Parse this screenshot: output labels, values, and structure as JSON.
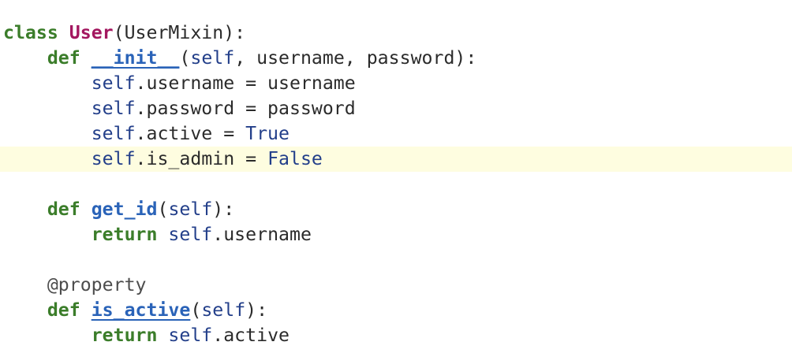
{
  "editor": {
    "language": "python",
    "current_line_index": 5,
    "colors": {
      "keyword": "#3b7d2a",
      "class_name": "#a3175f",
      "function_name": "#2a63b8",
      "self_and_literals": "#233f8a",
      "text": "#2b2b2b",
      "current_line_bg": "#fefde0"
    },
    "lines": [
      {
        "indent": "",
        "tokens": [
          {
            "t": "kw",
            "v": "class"
          },
          {
            "t": "plain",
            "v": " "
          },
          {
            "t": "cls",
            "v": "User"
          },
          {
            "t": "plain",
            "v": "(UserMixin):"
          }
        ]
      },
      {
        "indent": "    ",
        "tokens": [
          {
            "t": "kw",
            "v": "def"
          },
          {
            "t": "plain",
            "v": " "
          },
          {
            "t": "dunder",
            "v": "__init__"
          },
          {
            "t": "plain",
            "v": "("
          },
          {
            "t": "self",
            "v": "self"
          },
          {
            "t": "plain",
            "v": ", username, password):"
          }
        ]
      },
      {
        "indent": "        ",
        "tokens": [
          {
            "t": "self",
            "v": "self"
          },
          {
            "t": "plain",
            "v": ".username = username"
          }
        ]
      },
      {
        "indent": "        ",
        "tokens": [
          {
            "t": "self",
            "v": "self"
          },
          {
            "t": "plain",
            "v": ".password = password"
          }
        ]
      },
      {
        "indent": "        ",
        "tokens": [
          {
            "t": "self",
            "v": "self"
          },
          {
            "t": "plain",
            "v": ".active = "
          },
          {
            "t": "lit",
            "v": "True"
          }
        ]
      },
      {
        "indent": "        ",
        "tokens": [
          {
            "t": "self",
            "v": "self"
          },
          {
            "t": "plain",
            "v": ".is_admin = "
          },
          {
            "t": "lit",
            "v": "False"
          }
        ]
      },
      {
        "indent": "",
        "tokens": []
      },
      {
        "indent": "    ",
        "tokens": [
          {
            "t": "kw",
            "v": "def"
          },
          {
            "t": "plain",
            "v": " "
          },
          {
            "t": "fn",
            "v": "get_id"
          },
          {
            "t": "plain",
            "v": "("
          },
          {
            "t": "self",
            "v": "self"
          },
          {
            "t": "plain",
            "v": "):"
          }
        ]
      },
      {
        "indent": "        ",
        "tokens": [
          {
            "t": "kw",
            "v": "return"
          },
          {
            "t": "plain",
            "v": " "
          },
          {
            "t": "self",
            "v": "self"
          },
          {
            "t": "plain",
            "v": ".username"
          }
        ]
      },
      {
        "indent": "",
        "tokens": []
      },
      {
        "indent": "    ",
        "tokens": [
          {
            "t": "deco",
            "v": "@property"
          }
        ]
      },
      {
        "indent": "    ",
        "tokens": [
          {
            "t": "kw",
            "v": "def"
          },
          {
            "t": "plain",
            "v": " "
          },
          {
            "t": "dunder",
            "v": "is_active"
          },
          {
            "t": "plain",
            "v": "("
          },
          {
            "t": "self",
            "v": "self"
          },
          {
            "t": "plain",
            "v": "):"
          }
        ]
      },
      {
        "indent": "        ",
        "tokens": [
          {
            "t": "kw",
            "v": "return"
          },
          {
            "t": "plain",
            "v": " "
          },
          {
            "t": "self",
            "v": "self"
          },
          {
            "t": "plain",
            "v": ".active"
          }
        ]
      }
    ]
  }
}
